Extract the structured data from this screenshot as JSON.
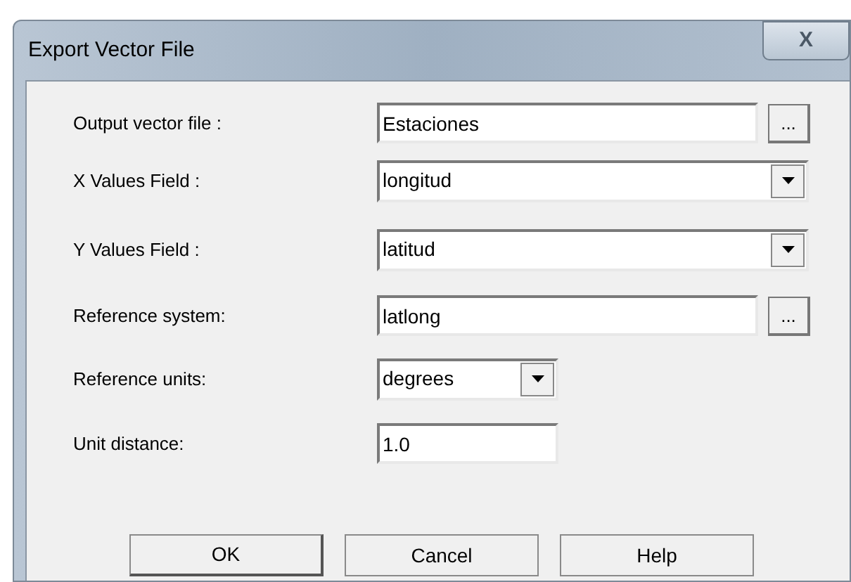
{
  "window": {
    "title": "Export Vector File",
    "close": "X"
  },
  "fields": [
    {
      "kind": "text",
      "label": "Output vector file :",
      "value": "Estaciones",
      "browse": "..."
    },
    {
      "kind": "select",
      "label": "X Values Field :",
      "value": "longitud"
    },
    {
      "kind": "select",
      "label": "Y Values Field :",
      "value": "latitud"
    },
    {
      "kind": "text",
      "label": "Reference system:",
      "value": "latlong",
      "browse": "..."
    },
    {
      "kind": "select",
      "label": "Reference units:",
      "value": "degrees"
    },
    {
      "kind": "text",
      "label": "Unit distance:",
      "value": "1.0"
    }
  ],
  "buttons": [
    "OK",
    "Cancel",
    "Help"
  ]
}
